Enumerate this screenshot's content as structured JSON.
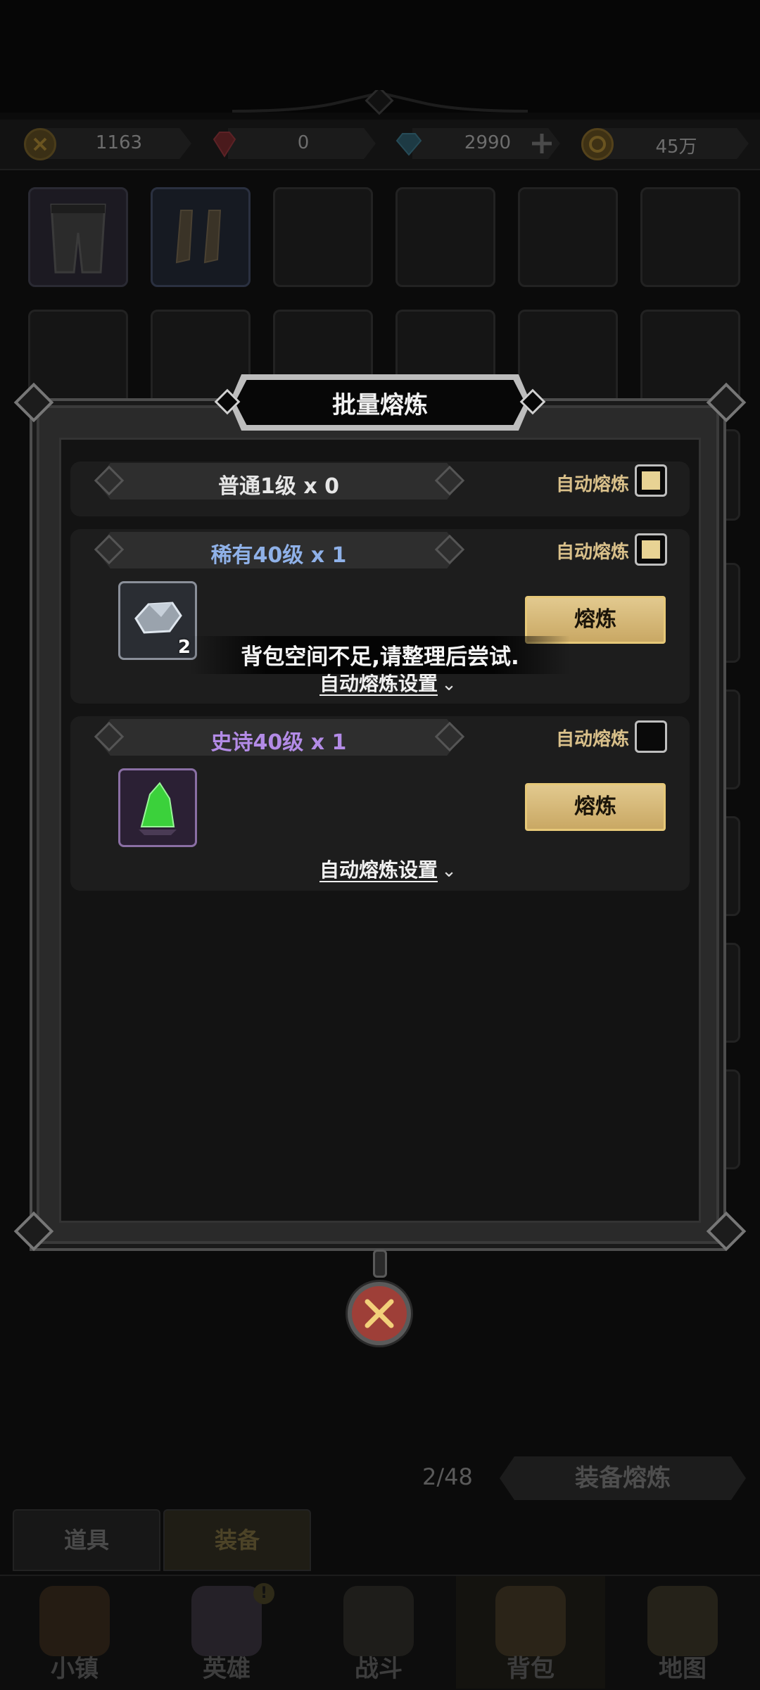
{
  "resources": [
    {
      "icon": "crossed-token-icon",
      "value": "1163"
    },
    {
      "icon": "red-gem-icon",
      "value": "0"
    },
    {
      "icon": "blue-diamond-icon",
      "value": "2990"
    },
    {
      "icon": "gold-coin-icon",
      "value": "45万"
    }
  ],
  "inventory": {
    "progress": "2/48",
    "smelt_button": "装备熔炼",
    "tabs": [
      {
        "label": "道具",
        "active": false
      },
      {
        "label": "装备",
        "active": true
      }
    ]
  },
  "bottom_nav": [
    {
      "label": "小镇",
      "icon": "town-icon",
      "active": false
    },
    {
      "label": "英雄",
      "icon": "hero-icon",
      "active": false,
      "badge": "!"
    },
    {
      "label": "战斗",
      "icon": "battle-swords-icon",
      "active": false
    },
    {
      "label": "背包",
      "icon": "backpack-icon",
      "active": true
    },
    {
      "label": "地图",
      "icon": "map-scroll-icon",
      "active": false
    }
  ],
  "modal": {
    "title": "批量熔炼",
    "sections": [
      {
        "title": "普通1级 x 0",
        "color": "#e6e6e6",
        "auto_label": "自动熔炼",
        "auto_checked": true
      },
      {
        "title": "稀有40级 x 1",
        "color": "#8fb1e8",
        "auto_label": "自动熔炼",
        "auto_checked": true,
        "item": {
          "icon": "rare-ore-icon",
          "qty": "2"
        },
        "button": "熔炼",
        "settings": "自动熔炼设置"
      },
      {
        "title": "史诗40级 x 1",
        "color": "#b38be6",
        "auto_label": "自动熔炼",
        "auto_checked": false,
        "item": {
          "icon": "green-crystal-icon"
        },
        "button": "熔炼",
        "settings": "自动熔炼设置"
      }
    ]
  },
  "toast": "背包空间不足,请整理后尝试."
}
